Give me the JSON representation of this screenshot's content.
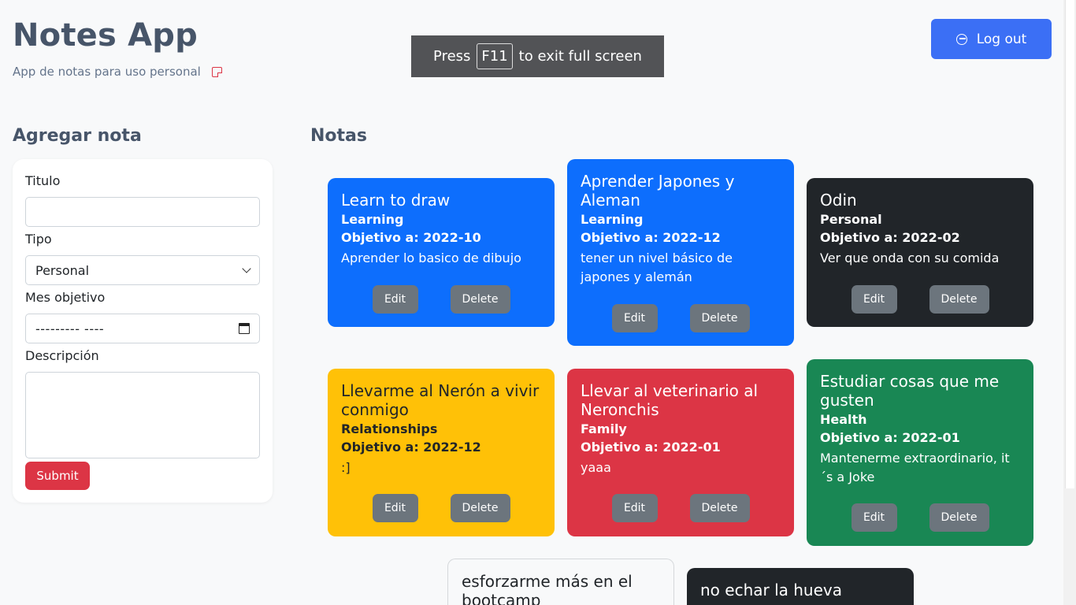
{
  "header": {
    "title": "Notes App",
    "subtitle": "App de notas para uso personal",
    "logout_label": "Log out"
  },
  "fullscreen_notice": {
    "press": "Press",
    "key": "F11",
    "rest": "to exit full screen"
  },
  "form": {
    "heading": "Agregar nota",
    "title_label": "Titulo",
    "title_value": "",
    "type_label": "Tipo",
    "type_selected": "Personal",
    "month_label": "Mes objetivo",
    "month_placeholder": "--------- ----",
    "description_label": "Descripción",
    "description_value": "",
    "submit_label": "Submit"
  },
  "notes_section": {
    "heading": "Notas",
    "edit_label": "Edit",
    "delete_label": "Delete",
    "notes": [
      {
        "title": "Learn to draw",
        "type": "Learning",
        "goal": "Objetivo a: 2022-10",
        "description": "Aprender lo basico de dibujo",
        "color": "#0d6efd"
      },
      {
        "title": "Aprender Japones y Aleman",
        "type": "Learning",
        "goal": "Objetivo a: 2022-12",
        "description": "tener un nivel básico de japones y alemán",
        "color": "#0d6efd"
      },
      {
        "title": "Odin",
        "type": "Personal",
        "goal": "Objetivo a: 2022-02",
        "description": "Ver que onda con su comida",
        "color": "#212529"
      },
      {
        "title": "Llevarme al Nerón a vivir conmigo",
        "type": "Relationships",
        "goal": "Objetivo a: 2022-12",
        "description": ":]",
        "color": "#ffc107"
      },
      {
        "title": "Llevar al veterinario al Neronchis",
        "type": "Family",
        "goal": "Objetivo a: 2022-01",
        "description": "yaaa",
        "color": "#dc3545"
      },
      {
        "title": "Estudiar cosas que me gusten",
        "type": "Health",
        "goal": "Objetivo a: 2022-01",
        "description": "Mantenerme extraordinario, it´s a Joke",
        "color": "#198754"
      },
      {
        "title": "esforzarme más en el bootcamp",
        "color": "#f8f9fa"
      },
      {
        "title": "no echar la hueva",
        "color": "#212529"
      }
    ]
  }
}
